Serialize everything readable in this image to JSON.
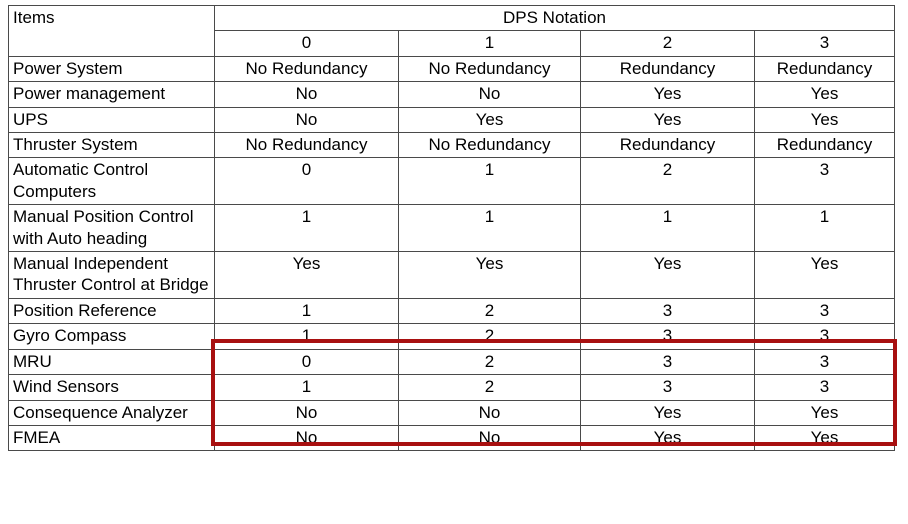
{
  "table": {
    "corner_label": "Items",
    "group_header": "DPS Notation",
    "column_headers": [
      "0",
      "1",
      "2",
      "3"
    ],
    "rows": [
      {
        "item": "Power System",
        "values": [
          "No Redundancy",
          "No Redundancy",
          "Redundancy",
          "Redundancy"
        ],
        "highlighted": false
      },
      {
        "item": "Power management",
        "values": [
          "No",
          "No",
          "Yes",
          "Yes"
        ],
        "highlighted": false
      },
      {
        "item": "UPS",
        "values": [
          "No",
          "Yes",
          "Yes",
          "Yes"
        ],
        "highlighted": false
      },
      {
        "item": "Thruster System",
        "values": [
          "No Redundancy",
          "No Redundancy",
          "Redundancy",
          "Redundancy"
        ],
        "highlighted": false
      },
      {
        "item": "Automatic Control Computers",
        "values": [
          "0",
          "1",
          "2",
          "3"
        ],
        "highlighted": false
      },
      {
        "item": "Manual Position Control with Auto heading",
        "values": [
          "1",
          "1",
          "1",
          "1"
        ],
        "highlighted": false
      },
      {
        "item": "Manual Independent Thruster Control at Bridge",
        "values": [
          "Yes",
          "Yes",
          "Yes",
          "Yes"
        ],
        "highlighted": false
      },
      {
        "item": "Position Reference",
        "values": [
          "1",
          "2",
          "3",
          "3"
        ],
        "highlighted": true
      },
      {
        "item": "Gyro Compass",
        "values": [
          "1",
          "2",
          "3",
          "3"
        ],
        "highlighted": true
      },
      {
        "item": "MRU",
        "values": [
          "0",
          "2",
          "3",
          "3"
        ],
        "highlighted": true
      },
      {
        "item": "Wind Sensors",
        "values": [
          "1",
          "2",
          "3",
          "3"
        ],
        "highlighted": true
      },
      {
        "item": "Consequence Analyzer",
        "values": [
          "No",
          "No",
          "Yes",
          "Yes"
        ],
        "highlighted": false
      },
      {
        "item": "FMEA",
        "values": [
          "No",
          "No",
          "Yes",
          "Yes"
        ],
        "highlighted": false
      }
    ]
  },
  "annotation": {
    "highlight_color": "#a81010",
    "highlight_label": "highlight-rectangle",
    "highlighted_rows": [
      "Position Reference",
      "Gyro Compass",
      "MRU",
      "Wind Sensors"
    ]
  }
}
